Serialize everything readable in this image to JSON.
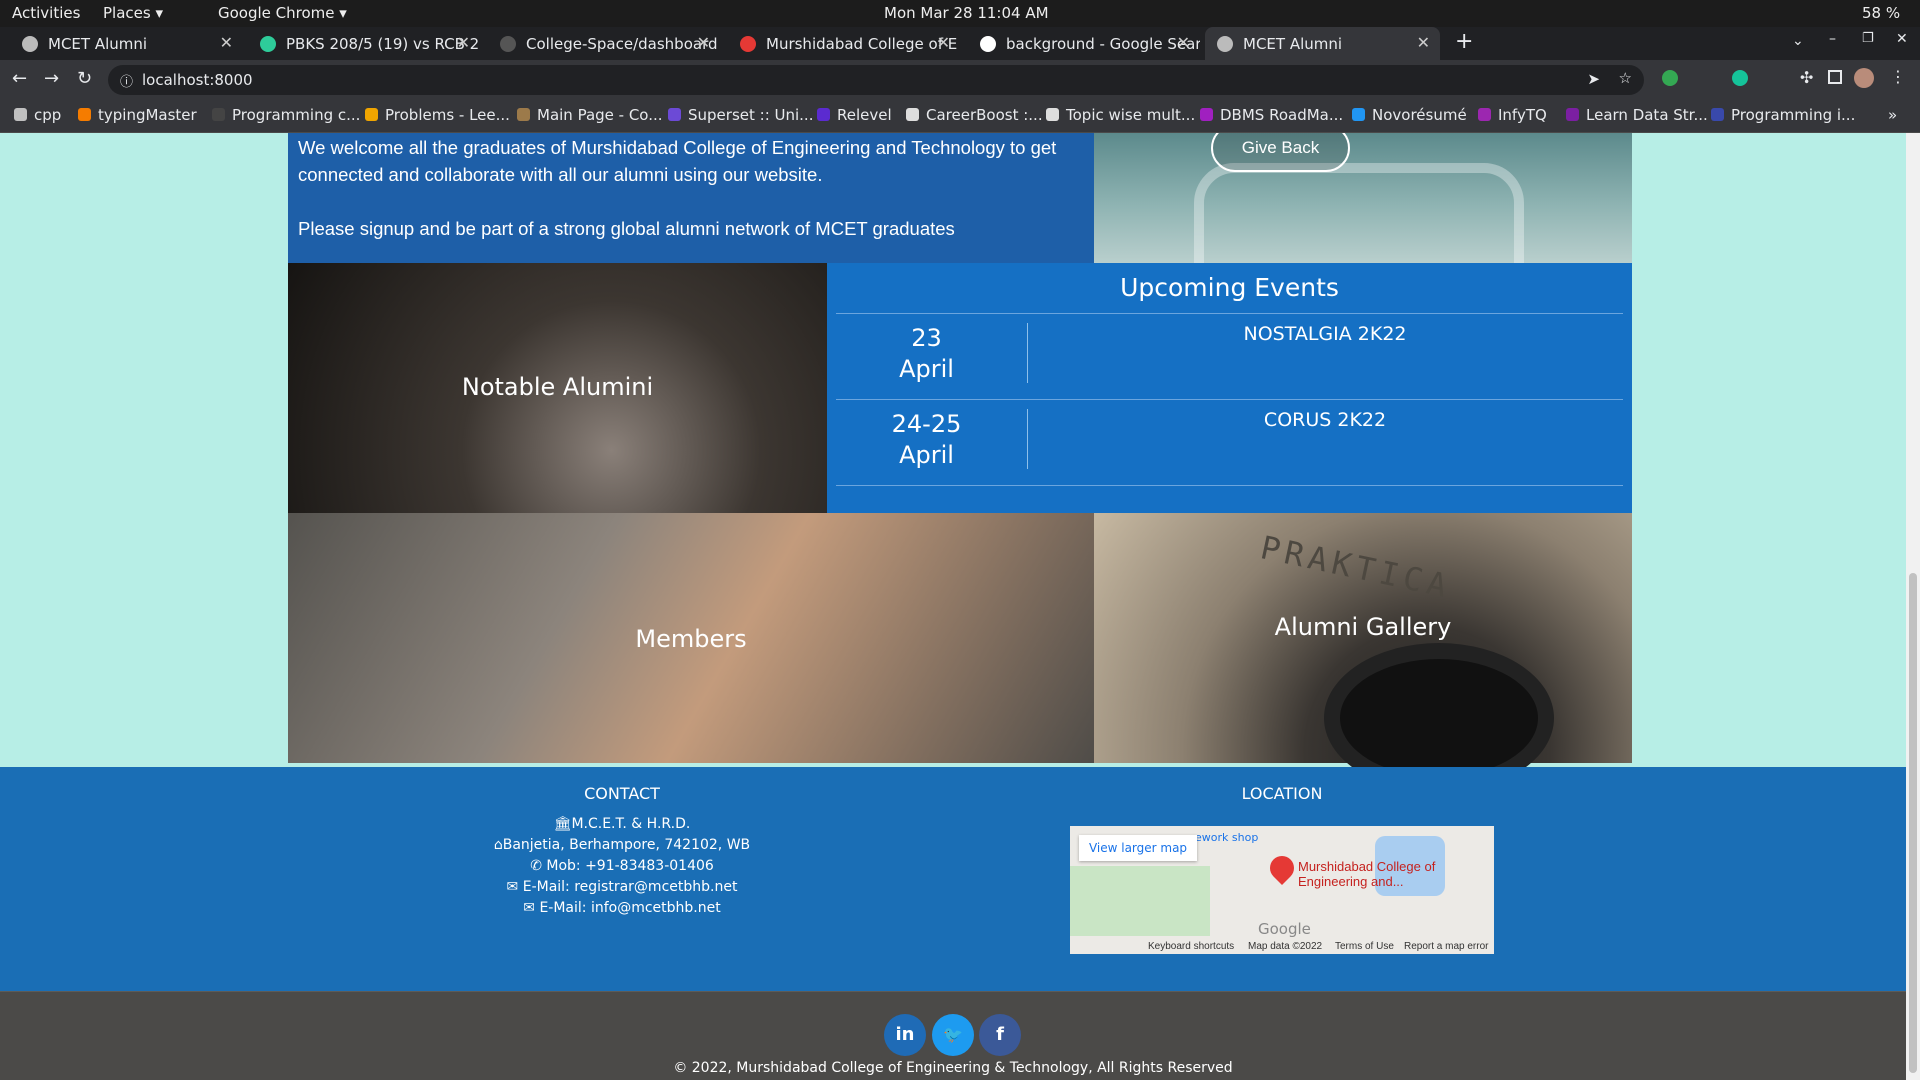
{
  "os_bar": {
    "activities": "Activities",
    "places": "Places ▾",
    "app": "Google Chrome ▾",
    "clock": "Mon Mar 28  11:04 AM",
    "battery": "58 %"
  },
  "tabs": [
    {
      "title": "MCET Alumni"
    },
    {
      "title": "PBKS 208/5 (19) vs RCB 2("
    },
    {
      "title": "College-Space/dashboard"
    },
    {
      "title": "Murshidabad College of E"
    },
    {
      "title": "background - Google Sear"
    },
    {
      "title": "MCET Alumni"
    }
  ],
  "new_tab": "+",
  "address": "localhost:8000",
  "bookmarks": [
    "cpp",
    "typingMaster",
    "Programming c...",
    "Problems - Lee...",
    "Main Page - Co...",
    "Superset :: Uni...",
    "Relevel",
    "CareerBoost :...",
    "Topic wise mult...",
    "DBMS RoadMa...",
    "Novorésumé",
    "InfyTQ",
    "Learn Data Str...",
    "Programming i..."
  ],
  "colors": {
    "accent": "#1a6eb5",
    "page_bg": "#b7eee6",
    "welcome_bg": "#1e5fa8",
    "events_bg": "#1570c4",
    "social_bg": "#4b4a48"
  },
  "welcome": {
    "line1": "We welcome all the graduates of Murshidabad College of Engineering and Technology to get connected and collaborate with all our alumni using our website.",
    "line2": "Please signup and be part of a strong global alumni network of MCET graduates"
  },
  "give_back_label": "Give Back",
  "notable_label": "Notable Alumini",
  "events": {
    "title": "Upcoming Events",
    "items": [
      {
        "date": "23\nApril",
        "name": "NOSTALGIA 2K22"
      },
      {
        "date": "24-25\nApril",
        "name": "CORUS 2K22"
      }
    ]
  },
  "members_label": "Members",
  "gallery_label": "Alumni Gallery",
  "gallery_brand_text": "PRAKTICA",
  "footer": {
    "contact_heading": "CONTACT",
    "location_heading": "LOCATION",
    "contact_lines": [
      {
        "icon": "institution-icon",
        "glyph": "🏛",
        "text": "M.C.E.T. & H.R.D."
      },
      {
        "icon": "map-pin-icon",
        "glyph": "⌂",
        "text": "Banjetia, Berhampore, 742102, WB"
      },
      {
        "icon": "phone-icon",
        "glyph": "✆",
        "text": "Mob: +91-83483-01406"
      },
      {
        "icon": "envelope-icon",
        "glyph": "✉",
        "text": "E-Mail: registrar@mcetbhb.net"
      },
      {
        "icon": "envelope-icon",
        "glyph": "✉",
        "text": "E-Mail: info@mcetbhb.net"
      }
    ],
    "map": {
      "view_larger": "View larger map",
      "place_name": "Murshidabad College of Engineering and...",
      "top_text": "ework shop",
      "google": "Google",
      "keyboard": "Keyboard shortcuts",
      "map_data": "Map data ©2022",
      "terms": "Terms of Use",
      "report": "Report a map error"
    }
  },
  "social": [
    {
      "name": "linkedin",
      "glyph": "in"
    },
    {
      "name": "twitter",
      "glyph": "🐦"
    },
    {
      "name": "facebook",
      "glyph": "f"
    }
  ],
  "copyright": "© 2022, Murshidabad College of Engineering & Technology, All Rights Reserved"
}
